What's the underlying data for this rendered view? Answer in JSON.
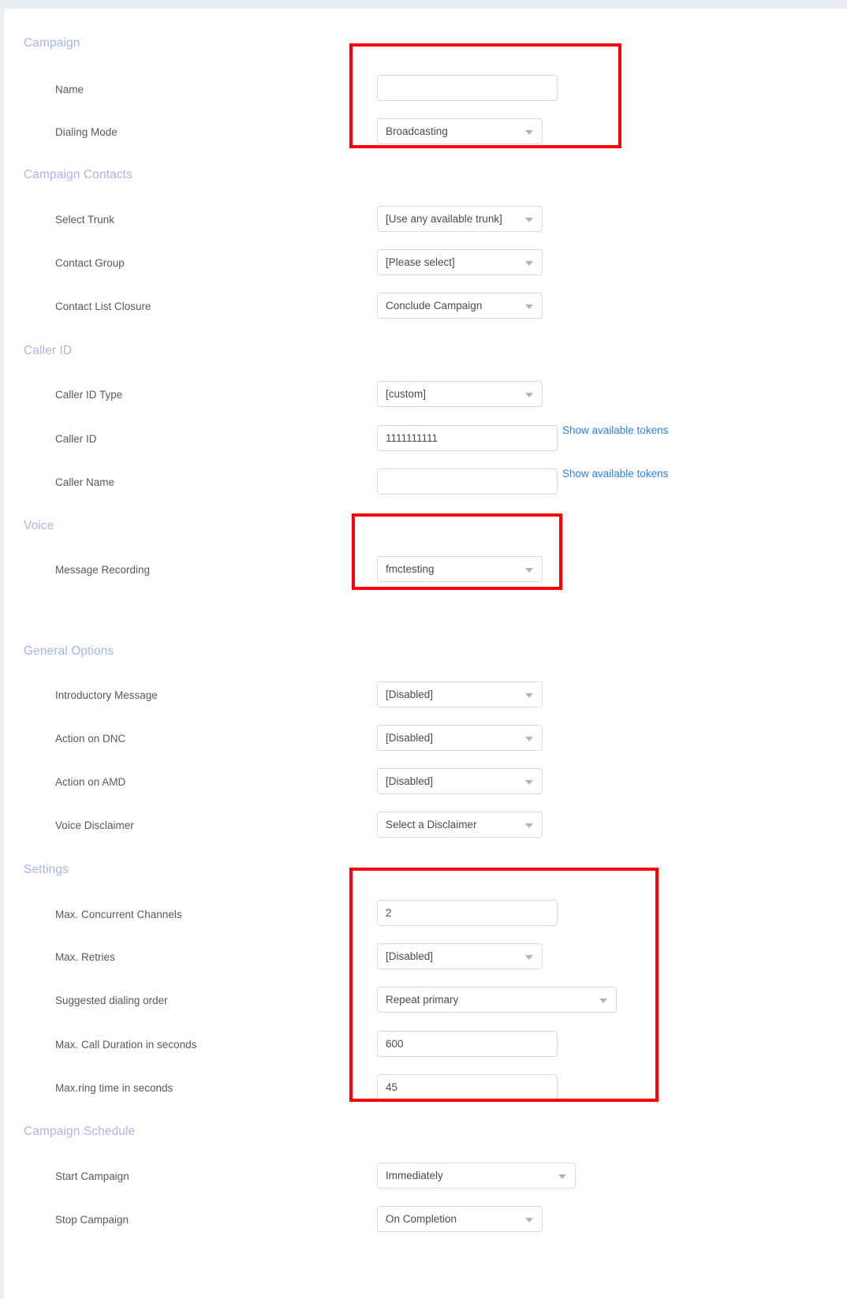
{
  "page": {
    "background_color": "#eceff3",
    "card_color": "#ffffff"
  },
  "colors": {
    "section_header": "#a9b5e8",
    "label": "#58595b",
    "link": "#2f80e0",
    "highlight": "#fb0007",
    "control_border": "#d6dade"
  },
  "sections": [
    {
      "id": "campaign",
      "title": "Campaign",
      "fields": [
        {
          "label": "Name",
          "type": "input",
          "value": "",
          "placeholder": ""
        },
        {
          "label": "Dialing Mode",
          "type": "select",
          "value": "Broadcasting"
        }
      ]
    },
    {
      "id": "campaign-contacts",
      "title": "Campaign Contacts",
      "fields": [
        {
          "label": "Select Trunk",
          "type": "select",
          "value": "[Use any available trunk]"
        },
        {
          "label": "Contact Group",
          "type": "select",
          "value": "[Please select]"
        },
        {
          "label": "Contact List Closure",
          "type": "select",
          "value": "Conclude Campaign"
        }
      ]
    },
    {
      "id": "caller-id",
      "title": "Caller ID",
      "fields": [
        {
          "label": "Caller ID Type",
          "type": "select",
          "value": "[custom]"
        },
        {
          "label": "Caller ID",
          "type": "input",
          "value": "1111111111",
          "link": "Show available tokens"
        },
        {
          "label": "Caller Name",
          "type": "input",
          "value": "",
          "link": "Show available tokens"
        }
      ]
    },
    {
      "id": "voice",
      "title": "Voice",
      "fields": [
        {
          "label": "Message Recording",
          "type": "select",
          "value": "fmctesting"
        }
      ]
    },
    {
      "id": "general-options",
      "title": "General Options",
      "fields": [
        {
          "label": "Introductory Message",
          "type": "select",
          "value": "[Disabled]"
        },
        {
          "label": "Action on DNC",
          "type": "select",
          "value": "[Disabled]"
        },
        {
          "label": "Action on AMD",
          "type": "select",
          "value": "[Disabled]"
        },
        {
          "label": "Voice Disclaimer",
          "type": "select",
          "value": "Select a Disclaimer"
        }
      ]
    },
    {
      "id": "settings",
      "title": "Settings",
      "fields": [
        {
          "label": "Max. Concurrent Channels",
          "type": "input",
          "value": "2"
        },
        {
          "label": "Max. Retries",
          "type": "select",
          "value": "[Disabled]"
        },
        {
          "label": "Suggested dialing order",
          "type": "select",
          "value": "Repeat primary"
        },
        {
          "label": "Max. Call Duration in seconds",
          "type": "input",
          "value": "600"
        },
        {
          "label": "Max.ring time in seconds",
          "type": "input",
          "value": "45"
        }
      ]
    },
    {
      "id": "campaign-schedule",
      "title": "Campaign Schedule",
      "fields": [
        {
          "label": "Start Campaign",
          "type": "select",
          "value": "Immediately"
        },
        {
          "label": "Stop Campaign",
          "type": "select",
          "value": "On Completion"
        }
      ]
    }
  ],
  "highlights": [
    {
      "id": "highlight-campaign",
      "label": "campaign-fields-highlight"
    },
    {
      "id": "highlight-voice",
      "label": "message-recording-highlight"
    },
    {
      "id": "highlight-settings",
      "label": "settings-fields-highlight"
    }
  ]
}
